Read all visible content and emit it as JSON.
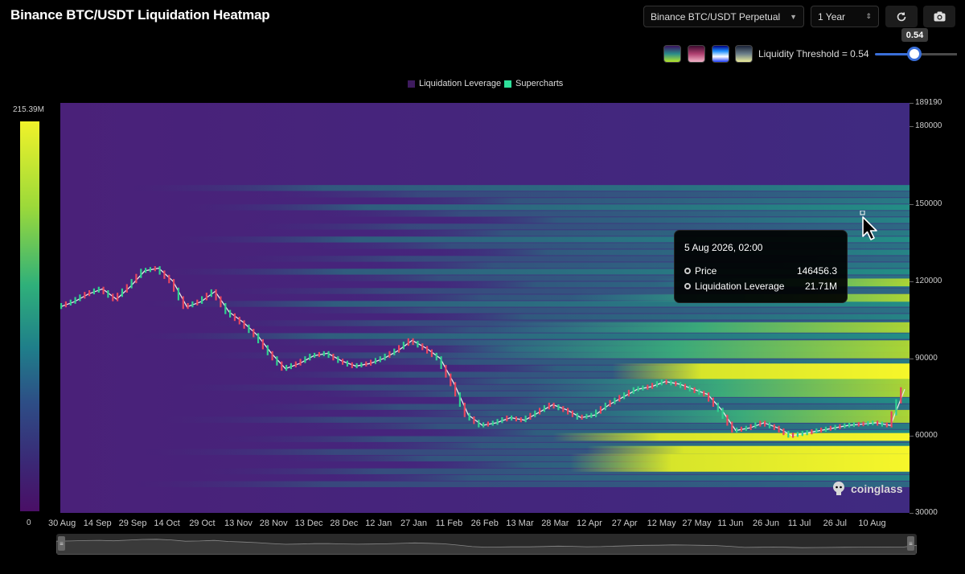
{
  "header": {
    "title": "Binance BTC/USDT Liquidation Heatmap",
    "symbol_select": "Binance BTC/USDT Perpetual",
    "range_select": "1 Year",
    "refresh_icon": "refresh-icon",
    "camera_icon": "camera-icon"
  },
  "controls": {
    "palettes": [
      "viridis",
      "pink",
      "blue",
      "cividis"
    ],
    "threshold_label": "Liquidity Threshold = 0.54",
    "threshold_value": 0.54,
    "threshold_tip": "0.54"
  },
  "legend": {
    "items": [
      {
        "label": "Liquidation Leverage",
        "color": "#3e1b5e"
      },
      {
        "label": "Supercharts",
        "color": "#2ee09a"
      }
    ]
  },
  "colorbar": {
    "max": "215.39M",
    "min": "0"
  },
  "chart_data": {
    "type": "heatmap",
    "y_axis_top": "189190",
    "y_ticks": [
      "180000",
      "150000",
      "120000",
      "90000",
      "60000",
      "30000"
    ],
    "x_ticks": [
      "30 Aug",
      "14 Sep",
      "29 Sep",
      "14 Oct",
      "29 Oct",
      "13 Nov",
      "28 Nov",
      "13 Dec",
      "28 Dec",
      "12 Jan",
      "27 Jan",
      "11 Feb",
      "26 Feb",
      "13 Mar",
      "28 Mar",
      "12 Apr",
      "27 Apr",
      "12 May",
      "27 May",
      "11 Jun",
      "26 Jun",
      "11 Jul",
      "26 Jul",
      "10 Aug"
    ],
    "ylim": [
      30000,
      189190
    ],
    "price_series": [
      110000,
      112000,
      115000,
      117000,
      113000,
      118000,
      124000,
      125000,
      120000,
      110000,
      112000,
      116000,
      108000,
      104000,
      99000,
      92000,
      86000,
      88000,
      91000,
      92000,
      89000,
      87000,
      88000,
      90000,
      93000,
      97000,
      94000,
      90000,
      80000,
      68000,
      64000,
      65000,
      67000,
      66000,
      69000,
      72000,
      70000,
      67000,
      68000,
      72000,
      75000,
      78000,
      79000,
      81000,
      80000,
      78000,
      76000,
      70000,
      62000,
      63000,
      65000,
      63000,
      60000,
      61000,
      62000,
      63000,
      64000,
      64500,
      65000,
      64000,
      78000
    ]
  },
  "tooltip": {
    "date": "5 Aug 2026, 02:00",
    "price_label": "Price",
    "price_value": "146456.3",
    "lev_label": "Liquidation Leverage",
    "lev_value": "21.71M"
  },
  "watermark": "coinglass"
}
